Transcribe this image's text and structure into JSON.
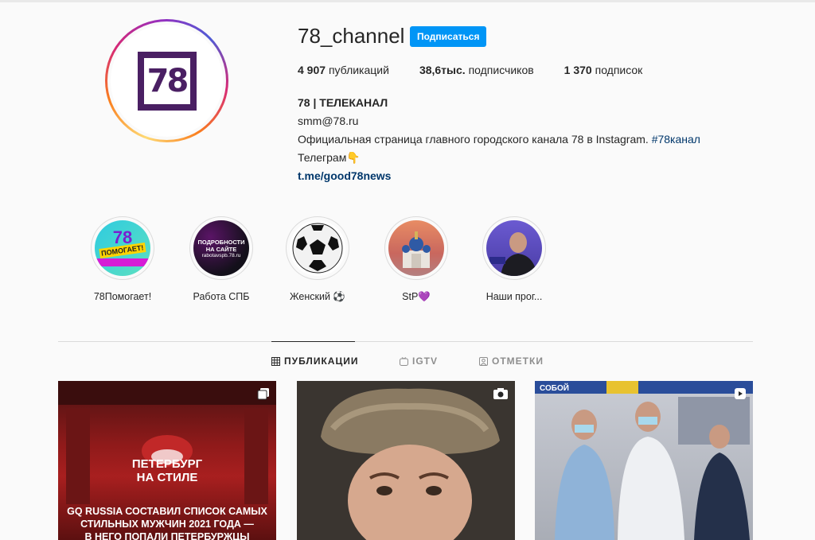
{
  "profile": {
    "username": "78_channel",
    "follow_label": "Подписаться",
    "logo_text": "78",
    "stats": {
      "posts_count": "4 907",
      "posts_label": "публикаций",
      "followers_count": "38,6тыс.",
      "followers_label": "подписчиков",
      "following_count": "1 370",
      "following_label": "подписок"
    },
    "bio": {
      "name": "78 | ТЕЛЕКАНАЛ",
      "email": "smm@78.ru",
      "description": "Официальная страница главного городского канала 78 в Instagram.",
      "hashtag": "#78канал",
      "telegram": "Телеграм",
      "telegram_emoji": "👇",
      "link": "t.me/good78news"
    }
  },
  "highlights": [
    {
      "label": "78Помогает!",
      "icon": "78-helps"
    },
    {
      "label": "Работа СПБ",
      "icon": "work-spb"
    },
    {
      "label": "Женский ⚽",
      "icon": "soccer-ball"
    },
    {
      "label": "StP💜",
      "icon": "cathedral"
    },
    {
      "label": "Наши прог...",
      "icon": "presenter"
    }
  ],
  "highlight_texts": {
    "h1_78": "78",
    "h1_help": "ПОМОГАЕТ!",
    "h2_line1": "ПОДРОБНОСТИ",
    "h2_line2": "НА САЙТЕ",
    "h2_line3": "rabotavspb.78.ru"
  },
  "tabs": {
    "posts": "ПУБЛИКАЦИИ",
    "igtv": "IGTV",
    "tagged": "ОТМЕТКИ"
  },
  "posts": [
    {
      "title_line1": "ПЕТЕРБУРГ",
      "title_line2": "НА СТИЛЕ",
      "text_line1": "GQ RUSSIA СОСТАВИЛ СПИСОК САМЫХ",
      "text_line2": "СТИЛЬНЫХ МУЖЧИН 2021 ГОДА —",
      "text_line3": "В НЕГО ПОПАЛИ ПЕТЕРБУРЖЦЫ",
      "badge": "carousel-icon"
    },
    {
      "badge": "video-icon"
    },
    {
      "badge": "reel-icon",
      "sign_text": "СОБОЙ"
    }
  ],
  "colors": {
    "accent": "#0095f6",
    "logo": "#4a1f63",
    "link": "#00376b"
  }
}
